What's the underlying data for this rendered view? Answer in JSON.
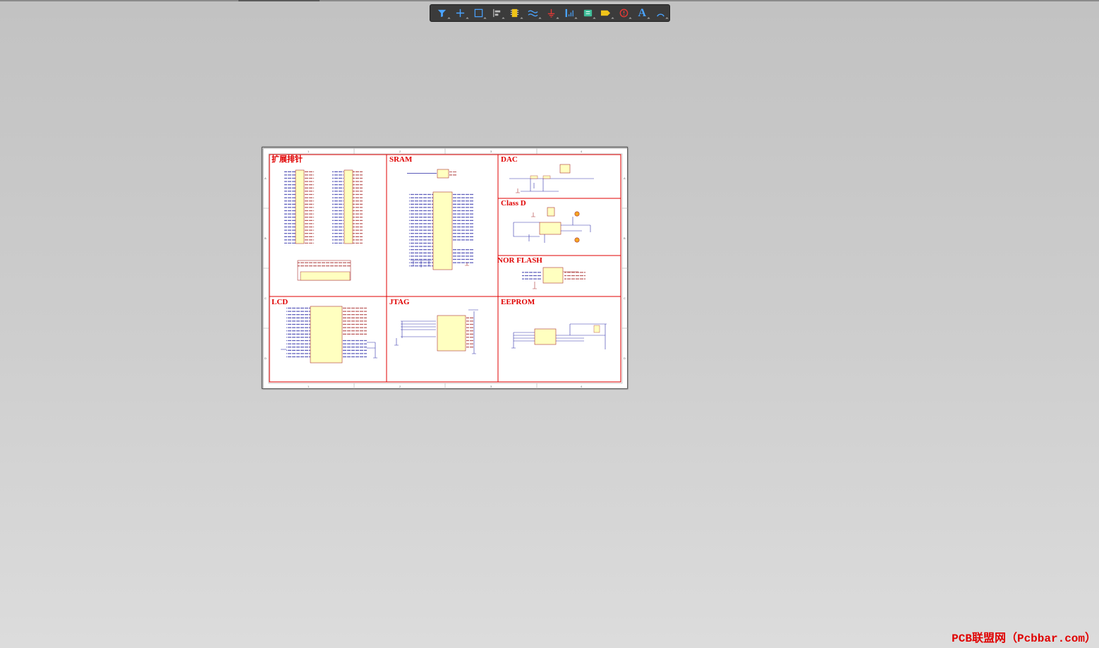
{
  "toolbar": {
    "tools": [
      {
        "name": "filter-icon"
      },
      {
        "name": "crosshair-icon"
      },
      {
        "name": "select-rect-icon"
      },
      {
        "name": "align-icon"
      },
      {
        "name": "component-icon"
      },
      {
        "name": "wire-icon"
      },
      {
        "name": "ground-icon"
      },
      {
        "name": "bus-icon"
      },
      {
        "name": "port-icon"
      },
      {
        "name": "net-label-icon"
      },
      {
        "name": "directive-icon"
      },
      {
        "name": "text-icon",
        "glyph": "A"
      },
      {
        "name": "arc-icon"
      }
    ]
  },
  "schematic": {
    "sections": [
      {
        "id": "header",
        "title": "扩展排针"
      },
      {
        "id": "sram",
        "title": "SRAM"
      },
      {
        "id": "dac",
        "title": "DAC"
      },
      {
        "id": "classd",
        "title": "Class D"
      },
      {
        "id": "norflash",
        "title": "NOR FLASH"
      },
      {
        "id": "lcd",
        "title": "LCD"
      },
      {
        "id": "jtag",
        "title": "JTAG"
      },
      {
        "id": "eeprom",
        "title": "EEPROM"
      }
    ],
    "border_marks": {
      "top": [
        "1",
        "2",
        "3",
        "4"
      ],
      "side": [
        "A",
        "B",
        "C",
        "D"
      ]
    }
  },
  "watermark": "PCB联盟网（Pcbbar.com）",
  "colors": {
    "frame": "#e00000",
    "component_fill": "#ffffc0",
    "wire": "#00008b",
    "toolbar_bg": "#3b3b3b",
    "icon_blue": "#4aa3ff",
    "icon_yellow": "#f0c419",
    "icon_red": "#e53935"
  }
}
